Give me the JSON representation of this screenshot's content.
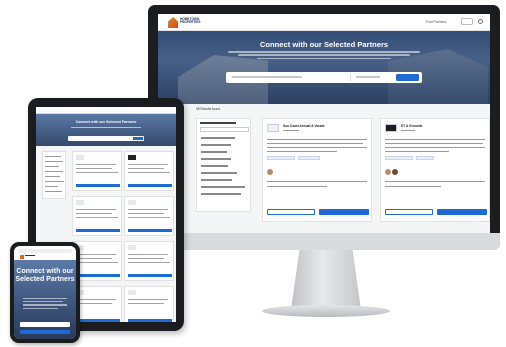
{
  "desktop": {
    "brand": "HOMETOWN PROPERTIES",
    "nav": {
      "link": "Find Partners",
      "button": "Log In"
    },
    "hero": {
      "title": "Connect with our Selected Partners"
    },
    "search": {
      "button_label": "Search"
    },
    "results_label": "98 Results found",
    "cards": [
      {
        "name": "Sun Coast Annual & Vacate"
      },
      {
        "name": "ET & Grounds"
      }
    ]
  },
  "tablet": {
    "hero": {
      "title": "Connect with our Selected Partners"
    }
  },
  "phone": {
    "hero": {
      "title": "Connect with our Selected Partners"
    }
  },
  "colors": {
    "accent": "#1e6bd6",
    "brand": "#203264",
    "logo": "#e88a2a"
  }
}
